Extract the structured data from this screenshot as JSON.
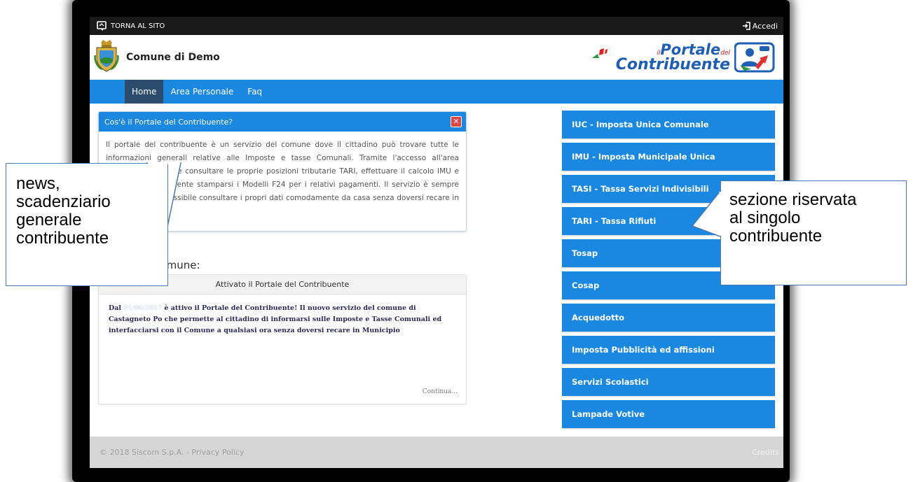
{
  "topbar": {
    "back_label": "TORNA AL SITO",
    "login_label": "Accedi"
  },
  "header": {
    "comune_name": "Comune di Demo",
    "portal_logo": {
      "line1_small": "il",
      "line1_big": "Portale",
      "line1_small2": "del",
      "line2": "Contribuente"
    }
  },
  "nav": {
    "items": [
      "Home",
      "Area Personale",
      "Faq"
    ],
    "active": "Home"
  },
  "infobox": {
    "title": "Cos'è il Portale del Contribuente?",
    "close_glyph": "✕",
    "text": "Il portale del contribuente è un servizio del comune dove il cittadino può trovare tutte le informazioni generali relative alle Imposte e tasse Comunali. Tramite l'accesso all'area riservata è possibile consultare le proprie posizioni tributarie TARI, effettuare il calcolo IMU e TASI ed eventualmente stamparsi i Modelli F24 per i relativi pagamenti. Il servizio è sempre attivo, quindi è possibile consultare i propri dati comodamente da casa senza doversi recare in comune."
  },
  "news": {
    "section_title": "News dal Comune:",
    "date_placeholder": "01/06/2017",
    "title": "Attivato il Portale del Contribuente",
    "body_prefix": "Dal",
    "body_blurred": "01/06/2017",
    "body_text": "è attivo il Portale del Contribuente! Il nuovo servizio del comune di Castagneto Po che permette al cittadino di informarsi sulle Imposte e Tasse Comunali ed interfacciarsi con il Comune a qualsiasi ora senza doversi recare in Municipio",
    "more_label": "Continua..."
  },
  "side_menu": [
    "IUC - Imposta Unica Comunale",
    "IMU - Imposta Municipale Unica",
    "TASI - Tassa Servizi Indivisibili",
    "TARI - Tassa Rifiuti",
    "Tosap",
    "Cosap",
    "Acquedotto",
    "Imposta Pubblicità ed affissioni",
    "Servizi Scolastici",
    "Lampade Votive"
  ],
  "footer": {
    "copyright": "© 2018 Siscom S.p.A. - Privacy Policy",
    "credits": "Credits"
  },
  "callouts": {
    "left": [
      "news,",
      "scadenziario",
      "generale",
      "contribuente"
    ],
    "right": [
      "sezione riservata",
      "al singolo",
      "contribuente"
    ]
  },
  "colors": {
    "primary_blue": "#1a88e0",
    "nav_active": "#2c4c6e",
    "close_red": "#e04545",
    "topbar": "#1a1a1a",
    "footer": "#d6d6d6"
  }
}
